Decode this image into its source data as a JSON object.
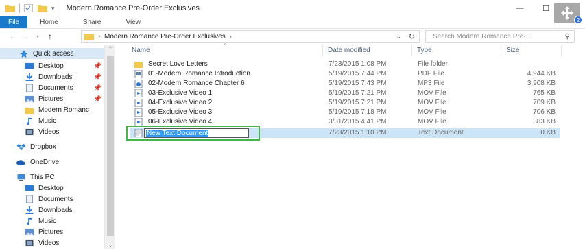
{
  "window": {
    "title": "Modern Romance Pre-Order Exclusives",
    "minimize": "—",
    "maximize": "☐",
    "move_badge": "2"
  },
  "ribbon": {
    "tabs": [
      "File",
      "Home",
      "Share",
      "View"
    ]
  },
  "addressbar": {
    "crumb": "Modern Romance Pre-Order Exclusives",
    "search_placeholder": "Search Modern Romance Pre-..."
  },
  "sidebar": {
    "items": [
      {
        "label": "Quick access",
        "icon": "star-icon"
      },
      {
        "label": "Desktop",
        "icon": "desktop-icon",
        "pinned": true
      },
      {
        "label": "Downloads",
        "icon": "downloads-icon",
        "pinned": true
      },
      {
        "label": "Documents",
        "icon": "documents-icon",
        "pinned": true
      },
      {
        "label": "Pictures",
        "icon": "pictures-icon",
        "pinned": true
      },
      {
        "label": "Modern Romanc",
        "icon": "folder-icon"
      },
      {
        "label": "Music",
        "icon": "music-icon"
      },
      {
        "label": "Videos",
        "icon": "videos-icon"
      },
      {
        "label": "Dropbox",
        "icon": "dropbox-icon"
      },
      {
        "label": "OneDrive",
        "icon": "onedrive-icon"
      },
      {
        "label": "This PC",
        "icon": "pc-icon"
      },
      {
        "label": "Desktop",
        "icon": "desktop-icon"
      },
      {
        "label": "Documents",
        "icon": "documents-icon"
      },
      {
        "label": "Downloads",
        "icon": "downloads-icon"
      },
      {
        "label": "Music",
        "icon": "music-icon"
      },
      {
        "label": "Pictures",
        "icon": "pictures-icon"
      },
      {
        "label": "Videos",
        "icon": "videos-icon"
      }
    ]
  },
  "columns": {
    "name": "Name",
    "date": "Date modified",
    "type": "Type",
    "size": "Size"
  },
  "files": [
    {
      "name": "Secret Love Letters",
      "date": "7/23/2015 1:08 PM",
      "type": "File folder",
      "size": "",
      "icon": "folder-icon"
    },
    {
      "name": "01-Modern Romance Introduction",
      "date": "5/19/2015 7:44 PM",
      "type": "PDF File",
      "size": "4,944 KB",
      "icon": "pdf-file-icon"
    },
    {
      "name": "02-Modern Romance Chapter 6",
      "date": "5/19/2015 7:43 PM",
      "type": "MP3 File",
      "size": "3,908 KB",
      "icon": "audio-file-icon"
    },
    {
      "name": "03-Exclusive Video 1",
      "date": "5/19/2015 7:21 PM",
      "type": "MOV File",
      "size": "765 KB",
      "icon": "video-file-icon"
    },
    {
      "name": "04-Exclusive Video 2",
      "date": "5/19/2015 7:21 PM",
      "type": "MOV File",
      "size": "709 KB",
      "icon": "video-file-icon"
    },
    {
      "name": "05-Exclusive Video 3",
      "date": "5/19/2015 7:18 PM",
      "type": "MOV File",
      "size": "706 KB",
      "icon": "video-file-icon"
    },
    {
      "name": "06-Exclusive Video 4",
      "date": "3/31/2015 4:41 PM",
      "type": "MOV File",
      "size": "383 KB",
      "icon": "video-file-icon"
    },
    {
      "name": "New Text Document",
      "date": "7/23/2015 1:10 PM",
      "type": "Text Document",
      "size": "0 KB",
      "icon": "text-file-icon",
      "renaming": true
    }
  ],
  "colors": {
    "accent": "#1979ca",
    "selection": "#cce4f7",
    "rename_highlight": "#3399ff",
    "callout": "#45b549"
  }
}
